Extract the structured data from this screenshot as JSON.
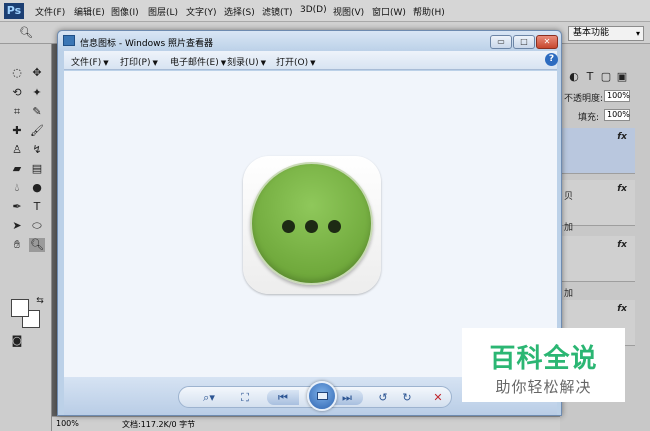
{
  "photoshop": {
    "logo": "Ps",
    "menus": [
      "文件(F)",
      "编辑(E)",
      "图像(I)",
      "图层(L)",
      "文字(Y)",
      "选择(S)",
      "滤镜(T)",
      "3D(D)",
      "视图(V)",
      "窗口(W)",
      "帮助(H)"
    ],
    "workspace": "基本功能",
    "opacity_label": "不透明度:",
    "opacity_value": "100%",
    "fill_label": "填充:",
    "fill_value": "100%",
    "fx": "fx",
    "layer_fragment_1": "贝",
    "layer_fragment_2": "加",
    "layer_fragment_3": "加",
    "zoom": "100%",
    "doc_info": "文档:117.2K/0 字节"
  },
  "viewer": {
    "title": "信息图标 - Windows 照片查看器",
    "menus": [
      {
        "label": "文件(F)"
      },
      {
        "label": "打印(P)"
      },
      {
        "label": "电子邮件(E)"
      },
      {
        "label": "刻录(U)"
      },
      {
        "label": "打开(O)"
      }
    ],
    "help": "?",
    "window_buttons": {
      "minimize": "▭",
      "maximize": "□",
      "close": "✕"
    },
    "controls": {
      "zoom": "⌕▾",
      "actual_size": "⛶",
      "previous": "⏮",
      "next": "⏭",
      "rotate_ccw": "↺",
      "rotate_cw": "↻",
      "delete": "✕"
    },
    "image": {
      "icon_color": "#78b043",
      "dot_color": "#1d2a14"
    }
  },
  "watermark": {
    "title": "百科全说",
    "subtitle": "助你轻松解决"
  }
}
